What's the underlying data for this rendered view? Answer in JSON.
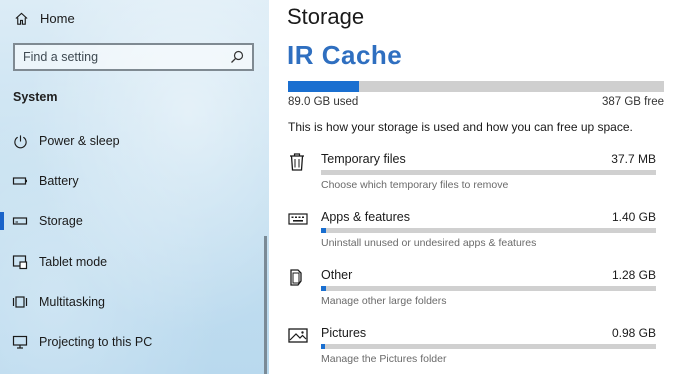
{
  "sidebar": {
    "home_label": "Home",
    "search_placeholder": "Find a setting",
    "section_title": "System",
    "items": [
      {
        "label": "Power & sleep",
        "icon": "power-icon",
        "active": false
      },
      {
        "label": "Battery",
        "icon": "battery-icon",
        "active": false
      },
      {
        "label": "Storage",
        "icon": "storage-icon",
        "active": true
      },
      {
        "label": "Tablet mode",
        "icon": "tablet-mode-icon",
        "active": false
      },
      {
        "label": "Multitasking",
        "icon": "multitasking-icon",
        "active": false
      },
      {
        "label": "Projecting to this PC",
        "icon": "projecting-icon",
        "active": false
      }
    ]
  },
  "main": {
    "title": "Storage",
    "drive_name": "IR Cache",
    "usage": {
      "used_label": "89.0 GB used",
      "free_label": "387 GB free",
      "used_fraction": 0.19
    },
    "description": "This is how your storage is used and how you can free up space.",
    "categories": [
      {
        "name": "Temporary files",
        "size": "37.7 MB",
        "sub": "Choose which temporary files to remove",
        "icon": "trash-icon",
        "fill": 0.0
      },
      {
        "name": "Apps & features",
        "size": "1.40 GB",
        "sub": "Uninstall unused or undesired apps & features",
        "icon": "keyboard-icon",
        "fill": 0.016
      },
      {
        "name": "Other",
        "size": "1.28 GB",
        "sub": "Manage other large folders",
        "icon": "folder-icon",
        "fill": 0.014
      },
      {
        "name": "Pictures",
        "size": "0.98 GB",
        "sub": "Manage the Pictures folder",
        "icon": "picture-icon",
        "fill": 0.011
      }
    ]
  },
  "colors": {
    "accent": "#1a6fd0",
    "drive_name": "#2f6fc0"
  }
}
